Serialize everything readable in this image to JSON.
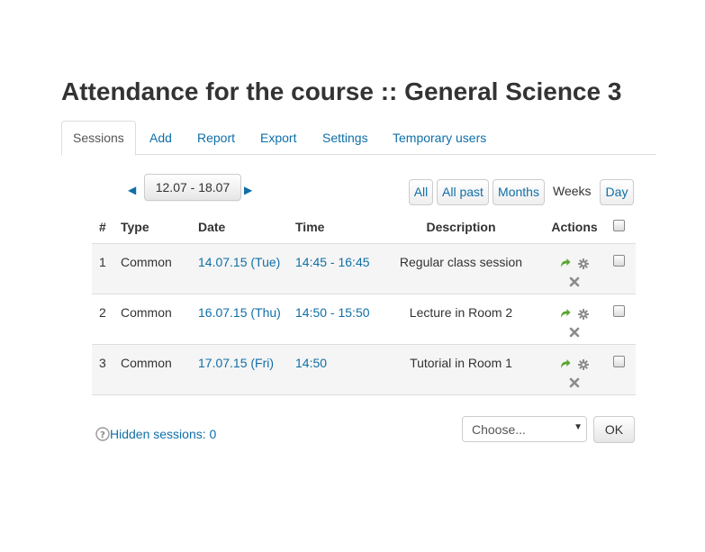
{
  "page": {
    "title": "Attendance for the course :: General Science 3"
  },
  "tabs": [
    {
      "label": "Sessions",
      "active": true
    },
    {
      "label": "Add"
    },
    {
      "label": "Report"
    },
    {
      "label": "Export"
    },
    {
      "label": "Settings"
    },
    {
      "label": "Temporary users"
    }
  ],
  "pager": {
    "prev_icon": "triangle-left-icon",
    "current_week": "12.07 - 18.07",
    "next_icon": "triangle-right-icon"
  },
  "views": {
    "all": "All",
    "all_past": "All past",
    "months": "Months",
    "weeks": "Weeks",
    "day": "Day",
    "current": "Weeks"
  },
  "table": {
    "headers": {
      "num": "#",
      "type": "Type",
      "date": "Date",
      "time": "Time",
      "description": "Description",
      "actions": "Actions"
    },
    "rows": [
      {
        "num": "1",
        "type": "Common",
        "date": "14.07.15 (Tue)",
        "time": "14:45 - 16:45",
        "description": "Regular class session"
      },
      {
        "num": "2",
        "type": "Common",
        "date": "16.07.15 (Thu)",
        "time": "14:50 - 15:50",
        "description": "Lecture in Room 2"
      },
      {
        "num": "3",
        "type": "Common",
        "date": "17.07.15 (Fri)",
        "time": "14:50",
        "description": "Tutorial in Room 1"
      }
    ],
    "action_icons": [
      "take-attendance-icon",
      "gear-icon",
      "delete-icon"
    ]
  },
  "footer": {
    "help_icon": "question-circle-icon",
    "hidden_sessions": "Hidden sessions: 0",
    "bulk_select": "Choose...",
    "ok": "OK"
  },
  "colors": {
    "link": "#0f6fa8",
    "text": "#333333",
    "action_green": "#5aa531",
    "action_grey": "#8c8c8c"
  }
}
